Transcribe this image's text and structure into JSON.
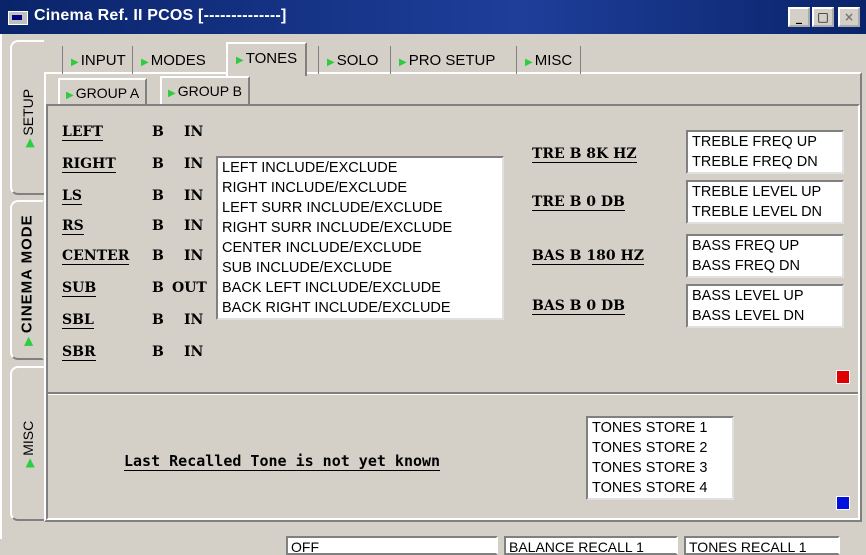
{
  "window": {
    "title": "Cinema Ref. II PCOS [--------------]",
    "buttons": [
      "_",
      "□",
      "×"
    ]
  },
  "side_tabs": [
    {
      "label": "SETUP"
    },
    {
      "label": "CINEMA MODE",
      "active": true
    },
    {
      "label": "MISC"
    }
  ],
  "top_tabs": [
    {
      "label": "INPUT"
    },
    {
      "label": "MODES"
    },
    {
      "label": "TONES",
      "active": true
    },
    {
      "label": "SOLO"
    },
    {
      "label": "PRO SETUP"
    },
    {
      "label": "MISC"
    }
  ],
  "sub_tabs": [
    {
      "label": "GROUP A"
    },
    {
      "label": "GROUP B",
      "active": true
    }
  ],
  "channels": [
    {
      "name": "LEFT",
      "group": "B",
      "state": "IN"
    },
    {
      "name": "RIGHT",
      "group": "B",
      "state": "IN"
    },
    {
      "name": "LS",
      "group": "B",
      "state": "IN"
    },
    {
      "name": "RS",
      "group": "B",
      "state": "IN"
    },
    {
      "name": "CENTER",
      "group": "B",
      "state": "IN"
    },
    {
      "name": "SUB",
      "group": "B",
      "state": "OUT"
    },
    {
      "name": "SBL",
      "group": "B",
      "state": "IN"
    },
    {
      "name": "SBR",
      "group": "B",
      "state": "IN"
    }
  ],
  "include_list": [
    "LEFT INCLUDE/EXCLUDE",
    "RIGHT INCLUDE/EXCLUDE",
    "LEFT SURR INCLUDE/EXCLUDE",
    "RIGHT SURR INCLUDE/EXCLUDE",
    "CENTER INCLUDE/EXCLUDE",
    "SUB INCLUDE/EXCLUDE",
    "BACK LEFT INCLUDE/EXCLUDE",
    "BACK RIGHT INCLUDE/EXCLUDE"
  ],
  "tone_controls": [
    {
      "label": "TRE B 8K HZ",
      "actions": [
        "TREBLE FREQ UP",
        "TREBLE FREQ DN"
      ]
    },
    {
      "label": "TRE B 0 DB",
      "actions": [
        "TREBLE LEVEL UP",
        "TREBLE LEVEL DN"
      ]
    },
    {
      "label": "BAS B 180 HZ",
      "actions": [
        "BASS FREQ UP",
        "BASS FREQ DN"
      ]
    },
    {
      "label": "BAS B 0 DB",
      "actions": [
        "BASS LEVEL UP",
        "BASS LEVEL DN"
      ]
    }
  ],
  "indicators": {
    "upper": "#e00000",
    "lower": "#0010e0"
  },
  "message": "Last Recalled Tone is not yet known",
  "tone_stores": [
    "TONES STORE 1",
    "TONES STORE 2",
    "TONES STORE 3",
    "TONES STORE 4"
  ],
  "status_bar": [
    "OFF",
    "BALANCE RECALL 1",
    "TONES RECALL 1"
  ],
  "colors": {
    "accent_dot": "#2ecc40",
    "titlebar": "#0a246a"
  }
}
